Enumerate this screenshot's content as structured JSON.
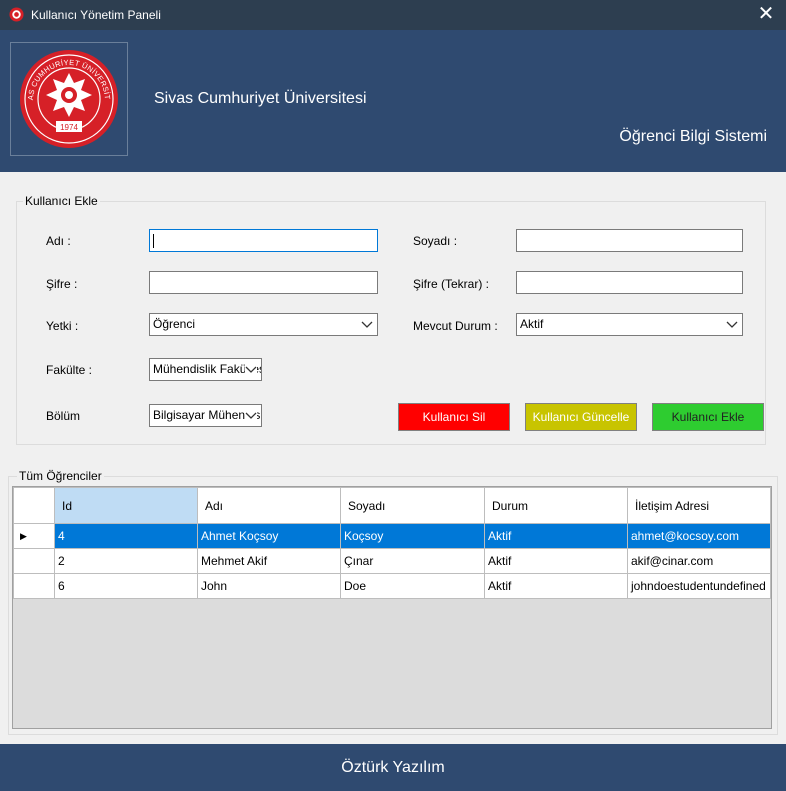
{
  "window": {
    "title": "Kullanıcı Yönetim Paneli",
    "close_glyph": "✕"
  },
  "header": {
    "university": "Sivas Cumhuriyet Üniversitesi",
    "system": "Öğrenci Bilgi Sistemi",
    "logo_text": "SİVAS CUMHURİYET ÜNİVERSİTESİ",
    "logo_year": "1974"
  },
  "form": {
    "group_label": "Kullanıcı Ekle",
    "name_label": "Adı :",
    "name_value": "",
    "surname_label": "Soyadı :",
    "surname_value": "",
    "password_label": "Şifre :",
    "password_repeat_label": "Şifre (Tekrar) :",
    "role_label": "Yetki :",
    "role_value": "Öğrenci",
    "status_label": "Mevcut Durum :",
    "status_value": "Aktif",
    "faculty_label": "Fakülte :",
    "faculty_value": "Mühendislik Fakültesi",
    "department_label": "Bölüm",
    "department_value": "Bilgisayar Mühendisliği",
    "delete_button": "Kullanıcı Sil",
    "update_button": "Kullanıcı Güncelle",
    "add_button": "Kullanıcı Ekle"
  },
  "students": {
    "group_label": "Tüm Öğrenciler",
    "columns": [
      "Id",
      "Adı",
      "Soyadı",
      "Durum",
      "İletişim Adresi"
    ],
    "rows": [
      [
        "4",
        "Ahmet Koçsoy",
        "Koçsoy",
        "Aktif",
        "ahmet@kocsoy.com"
      ],
      [
        "2",
        "Mehmet Akif",
        "Çınar",
        "Aktif",
        "akif@cinar.com"
      ],
      [
        "6",
        "John",
        "Doe",
        "Aktif",
        "johndoestudentundefined"
      ]
    ],
    "selected_row_marker": "▶"
  },
  "footer": {
    "text": "Öztürk Yazılım"
  },
  "colors": {
    "header_bg": "#2f4a70",
    "titlebar_bg": "#2d3e50",
    "selection": "#0078d7",
    "delete": "#ff0000",
    "update": "#c8c400",
    "add": "#2ecc30"
  }
}
